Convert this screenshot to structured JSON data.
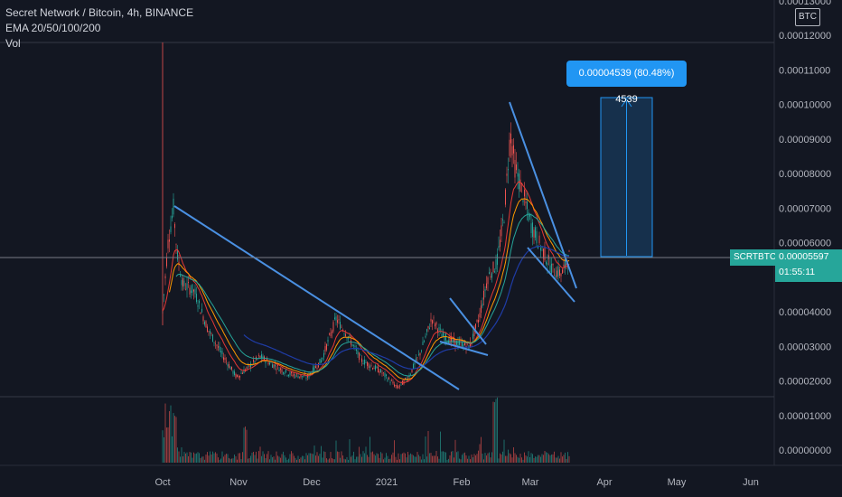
{
  "header": {
    "title": "Secret Network / Bitcoin, 4h, BINANCE",
    "indicators": "EMA 20/50/100/200",
    "volume": "Vol"
  },
  "price_axis": {
    "currency": "BTC",
    "ticks": [
      "0.00013000",
      "0.00012000",
      "0.00011000",
      "0.00010000",
      "0.00009000",
      "0.00008000",
      "0.00007000",
      "0.00006000",
      "0.00005000",
      "0.00004000",
      "0.00003000",
      "0.00002000",
      "0.00001000",
      "0.00000000"
    ]
  },
  "time_axis": {
    "labels": [
      "Oct",
      "Nov",
      "Dec",
      "2021",
      "Feb",
      "Mar",
      "Apr",
      "May",
      "Jun"
    ]
  },
  "last_price": {
    "symbol": "SCRTBTC",
    "price": "0.00005597",
    "countdown": "01:55:11"
  },
  "measure": {
    "label": "0.00004539 (80.48%) 4539"
  },
  "colors": {
    "background": "#131722",
    "up": "#26a69a",
    "down": "#ef5350",
    "trendline": "#4a90e2",
    "ema_red": "#e53935",
    "ema_orange": "#ff9800",
    "ema_teal": "#26a69a",
    "ema_navy": "#1f3ca6"
  }
}
